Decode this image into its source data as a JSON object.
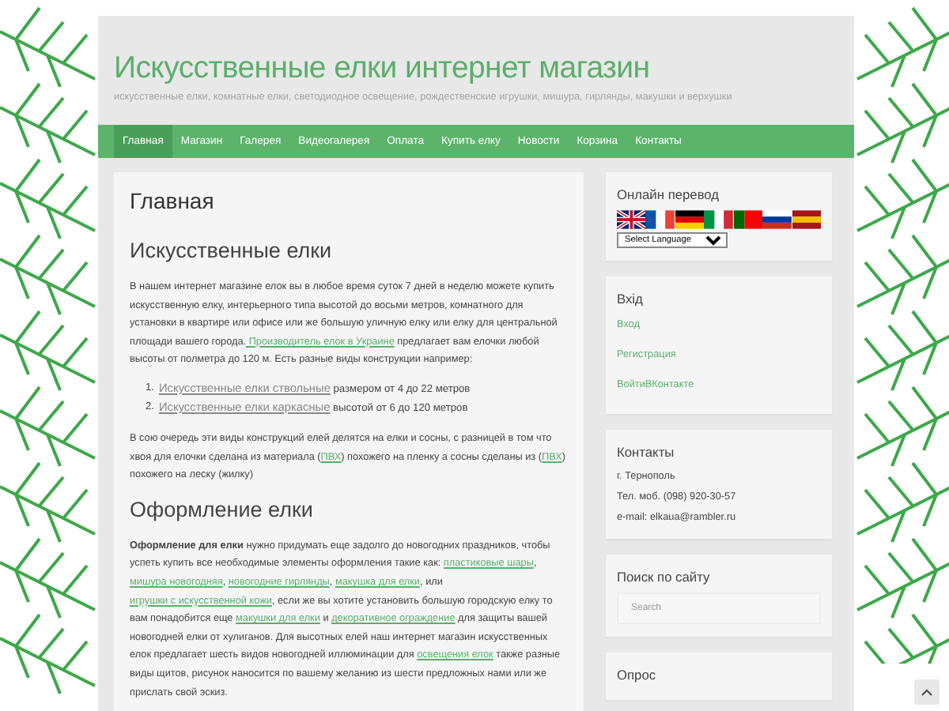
{
  "header": {
    "title": "Искусственные елки интернет магазин",
    "tagline": "искусственные елки, комнатные елки, светодиодное освещение, рождественские игрушки, мишура, гирлянды, макушки и верхушки"
  },
  "nav": [
    {
      "label": "Главная",
      "selected": true
    },
    {
      "label": "Магазин",
      "selected": false
    },
    {
      "label": "Галерея",
      "selected": false
    },
    {
      "label": "Видеогалерея",
      "selected": false
    },
    {
      "label": "Оплата",
      "selected": false
    },
    {
      "label": "Купить елку",
      "selected": false
    },
    {
      "label": "Новости",
      "selected": false
    },
    {
      "label": "Корзина",
      "selected": false
    },
    {
      "label": "Контакты",
      "selected": false
    }
  ],
  "content": {
    "page_title": "Главная",
    "blocks": [
      {
        "kind": "heading",
        "text": "Искусственные елки"
      },
      {
        "kind": "paragraph",
        "parts": [
          {
            "kind": "text",
            "text": "В нашем интернет магазине елок вы в любое время суток 7 дней в неделю можете купить искусственную елку, интерьерного типа высотой до восьми метров, комнатного для установки в квартире или офисе или же большую уличную елку или елку для центральной площади вашего города."
          },
          {
            "kind": "link",
            "text": " Производитель елок в Украине"
          },
          {
            "kind": "text",
            "text": " предлагает вам елочки любой высоты от полметра до 120 м. Есть разные виды конструкции например:"
          }
        ]
      },
      {
        "kind": "list",
        "items": [
          {
            "number": "1.",
            "link": "Искусственные елки ствольные",
            "text": " размером от 4  до 22  метров"
          },
          {
            "number": "2.",
            "link": "Искусственные елки каркасные",
            "text": " высотой от 6  до 120 метров"
          }
        ]
      },
      {
        "kind": "paragraph",
        "parts": [
          {
            "kind": "text",
            "text": "В сою очередь эти виды конструкций елей делятся на елки и сосны, с разницей  в том что хвоя для елочки сделана из материала ("
          },
          {
            "kind": "link",
            "text": "ПВХ"
          },
          {
            "kind": "text",
            "text": ") похожего на пленку а сосны сделаны из ("
          },
          {
            "kind": "link",
            "text": "ПВХ"
          },
          {
            "kind": "text",
            "text": ") похожего на леску (жилку)"
          }
        ]
      },
      {
        "kind": "heading",
        "text": "Оформление елки"
      },
      {
        "kind": "paragraph",
        "parts": [
          {
            "kind": "bold",
            "text": "Оформление для елки"
          },
          {
            "kind": "text",
            "text": " нужно придумать еще задолго до новогодних праздников, чтобы успеть купить все необходимые элементы оформления такие как: "
          },
          {
            "kind": "link",
            "text": "пластиковые шары"
          },
          {
            "kind": "text",
            "text": ", "
          },
          {
            "kind": "link",
            "text": "мишура новогодняя"
          },
          {
            "kind": "text",
            "text": ", "
          },
          {
            "kind": "link",
            "text": "новогодние гирлянды"
          },
          {
            "kind": "text",
            "text": ", "
          },
          {
            "kind": "link",
            "text": "макушка для елки"
          },
          {
            "kind": "text",
            "text": ", или "
          },
          {
            "kind": "link",
            "text": "игрушки с искусственной кожи"
          },
          {
            "kind": "text",
            "text": ", если же вы хотите установить большую городскую елку то вам понадобится еще "
          },
          {
            "kind": "link",
            "text": "макушки для елки"
          },
          {
            "kind": "text",
            "text": " и "
          },
          {
            "kind": "link",
            "text": "декоративное ограждение"
          },
          {
            "kind": "text",
            "text": " для защиты вашей новогодней елки от хулиганов. Для высотных елей наш интернет магазин искусственных елок предлагает шесть видов новогодней иллюминации для "
          },
          {
            "kind": "link",
            "text": "освещения елок"
          },
          {
            "kind": "text",
            "text": " также разные виды щитов, рисунок наносится по вашему желанию из шести предложных нами или же прислать свой эскиз."
          }
        ]
      }
    ]
  },
  "sidebar": [
    {
      "kind": "translate",
      "title": "Онлайн перевод",
      "select": "Select Language"
    },
    {
      "kind": "links",
      "title": "Вхід",
      "links": [
        "Вход",
        "Регистрация",
        "ВойтиВКонтакте"
      ]
    },
    {
      "kind": "lines",
      "title": "Контакты",
      "lines": [
        "г. Тернополь",
        "Тел. моб. (098) 920-30-57",
        "e-mail: elkaua@rambler.ru"
      ]
    },
    {
      "kind": "search",
      "title": "Поиск по сайту",
      "placeholder": "Search"
    },
    {
      "kind": "poll",
      "title": "Опрос"
    }
  ]
}
